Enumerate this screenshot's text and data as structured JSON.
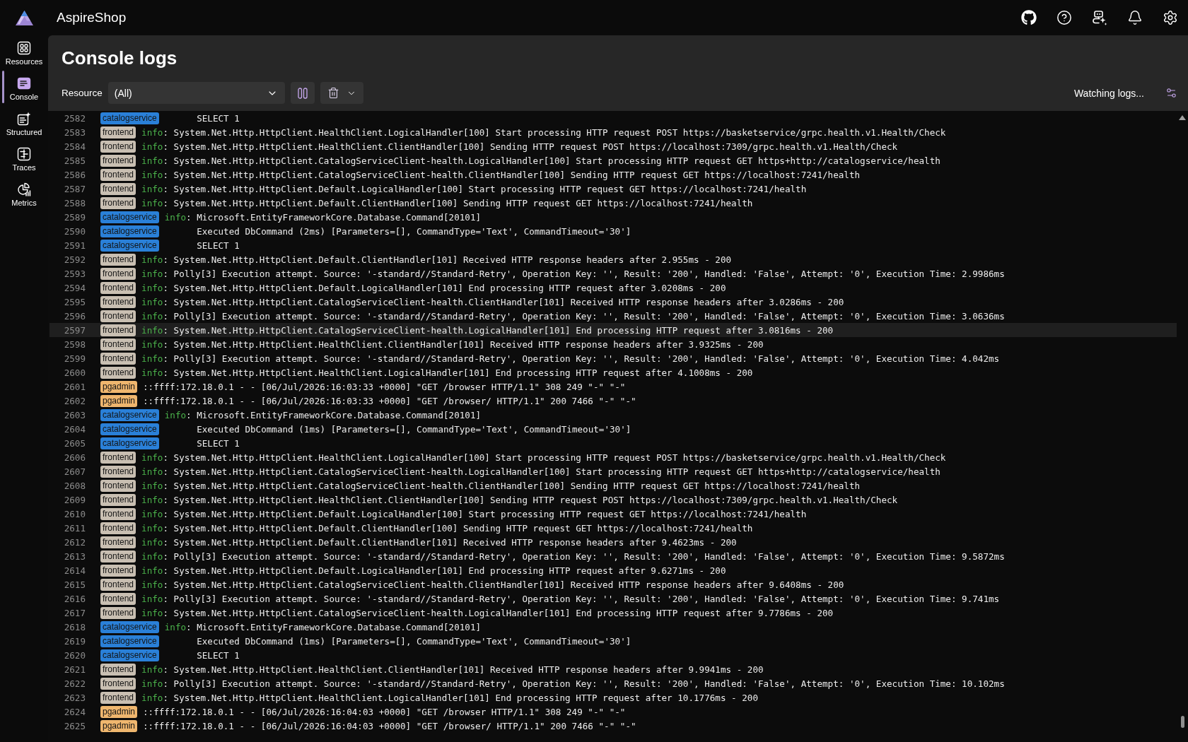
{
  "app": {
    "title": "AspireShop"
  },
  "nav": [
    {
      "label": "Resources",
      "selected": false
    },
    {
      "label": "Console",
      "selected": true
    },
    {
      "label": "Structured",
      "selected": false
    },
    {
      "label": "Traces",
      "selected": false
    },
    {
      "label": "Metrics",
      "selected": false
    }
  ],
  "page": {
    "title": "Console logs"
  },
  "toolbar": {
    "resource_filter": {
      "label": "Resource",
      "value": "(All)"
    },
    "status": "Watching logs..."
  },
  "log_rows": [
    {
      "line": "2582",
      "resource": "catalogservice",
      "color": "#2a80d8",
      "kind": "continued",
      "text": "SELECT 1",
      "selected": false
    },
    {
      "line": "2583",
      "resource": "frontend",
      "color": "#c9bfb2",
      "kind": "entry",
      "severity": "info",
      "text": ": System.Net.Http.HttpClient.HealthClient.LogicalHandler[100] Start processing HTTP request POST https://basketservice/grpc.health.v1.Health/Check",
      "selected": false
    },
    {
      "line": "2584",
      "resource": "frontend",
      "color": "#c9bfb2",
      "kind": "entry",
      "severity": "info",
      "text": ": System.Net.Http.HttpClient.HealthClient.ClientHandler[100] Sending HTTP request POST https://localhost:7309/grpc.health.v1.Health/Check",
      "selected": false
    },
    {
      "line": "2585",
      "resource": "frontend",
      "color": "#c9bfb2",
      "kind": "entry",
      "severity": "info",
      "text": ": System.Net.Http.HttpClient.CatalogServiceClient-health.LogicalHandler[100] Start processing HTTP request GET https+http://catalogservice/health",
      "selected": false
    },
    {
      "line": "2586",
      "resource": "frontend",
      "color": "#c9bfb2",
      "kind": "entry",
      "severity": "info",
      "text": ": System.Net.Http.HttpClient.CatalogServiceClient-health.ClientHandler[100] Sending HTTP request GET https://localhost:7241/health",
      "selected": false
    },
    {
      "line": "2587",
      "resource": "frontend",
      "color": "#c9bfb2",
      "kind": "entry",
      "severity": "info",
      "text": ": System.Net.Http.HttpClient.Default.LogicalHandler[100] Start processing HTTP request GET https://localhost:7241/health",
      "selected": false
    },
    {
      "line": "2588",
      "resource": "frontend",
      "color": "#c9bfb2",
      "kind": "entry",
      "severity": "info",
      "text": ": System.Net.Http.HttpClient.Default.ClientHandler[100] Sending HTTP request GET https://localhost:7241/health",
      "selected": false
    },
    {
      "line": "2589",
      "resource": "catalogservice",
      "color": "#2a80d8",
      "kind": "entry",
      "severity": "info",
      "text": ": Microsoft.EntityFrameworkCore.Database.Command[20101]",
      "selected": false
    },
    {
      "line": "2590",
      "resource": "catalogservice",
      "color": "#2a80d8",
      "kind": "continued",
      "text": "Executed DbCommand (2ms) [Parameters=[], CommandType='Text', CommandTimeout='30']",
      "selected": false
    },
    {
      "line": "2591",
      "resource": "catalogservice",
      "color": "#2a80d8",
      "kind": "continued",
      "text": "SELECT 1",
      "selected": false
    },
    {
      "line": "2592",
      "resource": "frontend",
      "color": "#c9bfb2",
      "kind": "entry",
      "severity": "info",
      "text": ": System.Net.Http.HttpClient.Default.ClientHandler[101] Received HTTP response headers after 2.955ms - 200",
      "selected": false
    },
    {
      "line": "2593",
      "resource": "frontend",
      "color": "#c9bfb2",
      "kind": "entry",
      "severity": "info",
      "text": ": Polly[3] Execution attempt. Source: '-standard//Standard-Retry', Operation Key: '', Result: '200', Handled: 'False', Attempt: '0', Execution Time: 2.9986ms",
      "selected": false
    },
    {
      "line": "2594",
      "resource": "frontend",
      "color": "#c9bfb2",
      "kind": "entry",
      "severity": "info",
      "text": ": System.Net.Http.HttpClient.Default.LogicalHandler[101] End processing HTTP request after 3.0208ms - 200",
      "selected": false
    },
    {
      "line": "2595",
      "resource": "frontend",
      "color": "#c9bfb2",
      "kind": "entry",
      "severity": "info",
      "text": ": System.Net.Http.HttpClient.CatalogServiceClient-health.ClientHandler[101] Received HTTP response headers after 3.0286ms - 200",
      "selected": false
    },
    {
      "line": "2596",
      "resource": "frontend",
      "color": "#c9bfb2",
      "kind": "entry",
      "severity": "info",
      "text": ": Polly[3] Execution attempt. Source: '-standard//Standard-Retry', Operation Key: '', Result: '200', Handled: 'False', Attempt: '0', Execution Time: 3.0636ms",
      "selected": false
    },
    {
      "line": "2597",
      "resource": "frontend",
      "color": "#c9bfb2",
      "kind": "entry",
      "severity": "info",
      "text": ": System.Net.Http.HttpClient.CatalogServiceClient-health.LogicalHandler[101] End processing HTTP request after 3.0816ms - 200",
      "selected": true
    },
    {
      "line": "2598",
      "resource": "frontend",
      "color": "#c9bfb2",
      "kind": "entry",
      "severity": "info",
      "text": ": System.Net.Http.HttpClient.HealthClient.ClientHandler[101] Received HTTP response headers after 3.9325ms - 200",
      "selected": false
    },
    {
      "line": "2599",
      "resource": "frontend",
      "color": "#c9bfb2",
      "kind": "entry",
      "severity": "info",
      "text": ": Polly[3] Execution attempt. Source: '-standard//Standard-Retry', Operation Key: '', Result: '200', Handled: 'False', Attempt: '0', Execution Time: 4.042ms",
      "selected": false
    },
    {
      "line": "2600",
      "resource": "frontend",
      "color": "#c9bfb2",
      "kind": "entry",
      "severity": "info",
      "text": ": System.Net.Http.HttpClient.HealthClient.LogicalHandler[101] End processing HTTP request after 4.1008ms - 200",
      "selected": false
    },
    {
      "line": "2601",
      "resource": "pgadmin",
      "color": "#efb66e",
      "kind": "raw",
      "text": "::ffff:172.18.0.1 - - [06/Jul/2026:16:03:33 +0000] \"GET /browser HTTP/1.1\" 308 249 \"-\" \"-\"",
      "selected": false
    },
    {
      "line": "2602",
      "resource": "pgadmin",
      "color": "#efb66e",
      "kind": "raw",
      "text": "::ffff:172.18.0.1 - - [06/Jul/2026:16:03:33 +0000] \"GET /browser/ HTTP/1.1\" 200 7466 \"-\" \"-\"",
      "selected": false
    },
    {
      "line": "2603",
      "resource": "catalogservice",
      "color": "#2a80d8",
      "kind": "entry",
      "severity": "info",
      "text": ": Microsoft.EntityFrameworkCore.Database.Command[20101]",
      "selected": false
    },
    {
      "line": "2604",
      "resource": "catalogservice",
      "color": "#2a80d8",
      "kind": "continued",
      "text": "Executed DbCommand (1ms) [Parameters=[], CommandType='Text', CommandTimeout='30']",
      "selected": false
    },
    {
      "line": "2605",
      "resource": "catalogservice",
      "color": "#2a80d8",
      "kind": "continued",
      "text": "SELECT 1",
      "selected": false
    },
    {
      "line": "2606",
      "resource": "frontend",
      "color": "#c9bfb2",
      "kind": "entry",
      "severity": "info",
      "text": ": System.Net.Http.HttpClient.HealthClient.LogicalHandler[100] Start processing HTTP request POST https://basketservice/grpc.health.v1.Health/Check",
      "selected": false
    },
    {
      "line": "2607",
      "resource": "frontend",
      "color": "#c9bfb2",
      "kind": "entry",
      "severity": "info",
      "text": ": System.Net.Http.HttpClient.CatalogServiceClient-health.LogicalHandler[100] Start processing HTTP request GET https+http://catalogservice/health",
      "selected": false
    },
    {
      "line": "2608",
      "resource": "frontend",
      "color": "#c9bfb2",
      "kind": "entry",
      "severity": "info",
      "text": ": System.Net.Http.HttpClient.CatalogServiceClient-health.ClientHandler[100] Sending HTTP request GET https://localhost:7241/health",
      "selected": false
    },
    {
      "line": "2609",
      "resource": "frontend",
      "color": "#c9bfb2",
      "kind": "entry",
      "severity": "info",
      "text": ": System.Net.Http.HttpClient.HealthClient.ClientHandler[100] Sending HTTP request POST https://localhost:7309/grpc.health.v1.Health/Check",
      "selected": false
    },
    {
      "line": "2610",
      "resource": "frontend",
      "color": "#c9bfb2",
      "kind": "entry",
      "severity": "info",
      "text": ": System.Net.Http.HttpClient.Default.LogicalHandler[100] Start processing HTTP request GET https://localhost:7241/health",
      "selected": false
    },
    {
      "line": "2611",
      "resource": "frontend",
      "color": "#c9bfb2",
      "kind": "entry",
      "severity": "info",
      "text": ": System.Net.Http.HttpClient.Default.ClientHandler[100] Sending HTTP request GET https://localhost:7241/health",
      "selected": false
    },
    {
      "line": "2612",
      "resource": "frontend",
      "color": "#c9bfb2",
      "kind": "entry",
      "severity": "info",
      "text": ": System.Net.Http.HttpClient.Default.ClientHandler[101] Received HTTP response headers after 9.4623ms - 200",
      "selected": false
    },
    {
      "line": "2613",
      "resource": "frontend",
      "color": "#c9bfb2",
      "kind": "entry",
      "severity": "info",
      "text": ": Polly[3] Execution attempt. Source: '-standard//Standard-Retry', Operation Key: '', Result: '200', Handled: 'False', Attempt: '0', Execution Time: 9.5872ms",
      "selected": false
    },
    {
      "line": "2614",
      "resource": "frontend",
      "color": "#c9bfb2",
      "kind": "entry",
      "severity": "info",
      "text": ": System.Net.Http.HttpClient.Default.LogicalHandler[101] End processing HTTP request after 9.6271ms - 200",
      "selected": false
    },
    {
      "line": "2615",
      "resource": "frontend",
      "color": "#c9bfb2",
      "kind": "entry",
      "severity": "info",
      "text": ": System.Net.Http.HttpClient.CatalogServiceClient-health.ClientHandler[101] Received HTTP response headers after 9.6408ms - 200",
      "selected": false
    },
    {
      "line": "2616",
      "resource": "frontend",
      "color": "#c9bfb2",
      "kind": "entry",
      "severity": "info",
      "text": ": Polly[3] Execution attempt. Source: '-standard//Standard-Retry', Operation Key: '', Result: '200', Handled: 'False', Attempt: '0', Execution Time: 9.741ms",
      "selected": false
    },
    {
      "line": "2617",
      "resource": "frontend",
      "color": "#c9bfb2",
      "kind": "entry",
      "severity": "info",
      "text": ": System.Net.Http.HttpClient.CatalogServiceClient-health.LogicalHandler[101] End processing HTTP request after 9.7786ms - 200",
      "selected": false
    },
    {
      "line": "2618",
      "resource": "catalogservice",
      "color": "#2a80d8",
      "kind": "entry",
      "severity": "info",
      "text": ": Microsoft.EntityFrameworkCore.Database.Command[20101]",
      "selected": false
    },
    {
      "line": "2619",
      "resource": "catalogservice",
      "color": "#2a80d8",
      "kind": "continued",
      "text": "Executed DbCommand (1ms) [Parameters=[], CommandType='Text', CommandTimeout='30']",
      "selected": false
    },
    {
      "line": "2620",
      "resource": "catalogservice",
      "color": "#2a80d8",
      "kind": "continued",
      "text": "SELECT 1",
      "selected": false
    },
    {
      "line": "2621",
      "resource": "frontend",
      "color": "#c9bfb2",
      "kind": "entry",
      "severity": "info",
      "text": ": System.Net.Http.HttpClient.HealthClient.ClientHandler[101] Received HTTP response headers after 9.9941ms - 200",
      "selected": false
    },
    {
      "line": "2622",
      "resource": "frontend",
      "color": "#c9bfb2",
      "kind": "entry",
      "severity": "info",
      "text": ": Polly[3] Execution attempt. Source: '-standard//Standard-Retry', Operation Key: '', Result: '200', Handled: 'False', Attempt: '0', Execution Time: 10.102ms",
      "selected": false
    },
    {
      "line": "2623",
      "resource": "frontend",
      "color": "#c9bfb2",
      "kind": "entry",
      "severity": "info",
      "text": ": System.Net.Http.HttpClient.HealthClient.LogicalHandler[101] End processing HTTP request after 10.1776ms - 200",
      "selected": false
    },
    {
      "line": "2624",
      "resource": "pgadmin",
      "color": "#efb66e",
      "kind": "raw",
      "text": "::ffff:172.18.0.1 - - [06/Jul/2026:16:04:03 +0000] \"GET /browser HTTP/1.1\" 308 249 \"-\" \"-\"",
      "selected": false
    },
    {
      "line": "2625",
      "resource": "pgadmin",
      "color": "#efb66e",
      "kind": "raw",
      "text": "::ffff:172.18.0.1 - - [06/Jul/2026:16:04:03 +0000] \"GET /browser/ HTTP/1.1\" 200 7466 \"-\" \"-\"",
      "selected": false
    }
  ]
}
